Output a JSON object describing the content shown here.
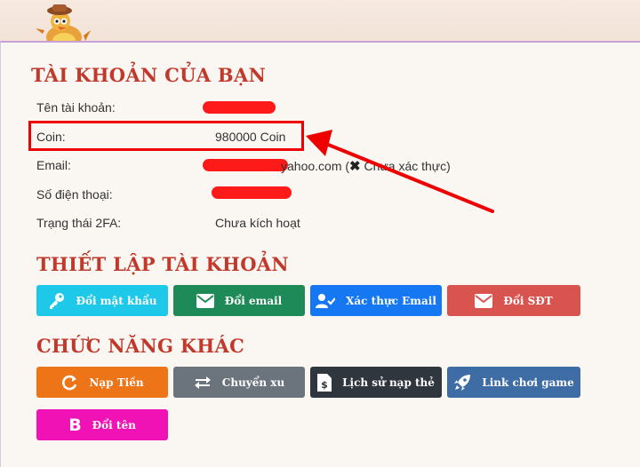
{
  "account": {
    "title": "TÀI KHOẢN CỦA BẠN",
    "username_label": "Tên tài khoản:",
    "coin_label": "Coin:",
    "coin_value": "980000 Coin",
    "email_label": "Email:",
    "email_visible_suffix": "yahoo.com (",
    "email_status": "Chưa xác thực)",
    "phone_label": "Số điện thoại:",
    "twofa_label": "Trạng thái 2FA:",
    "twofa_value": "Chưa kích hoạt"
  },
  "settings": {
    "title": "THIẾT LẬP TÀI KHOẢN",
    "buttons": [
      {
        "label": "Đổi mật khẩu",
        "icon": "key-icon",
        "color": "#1ec8e8"
      },
      {
        "label": "Đổi email",
        "icon": "envelope-icon",
        "color": "#1e8a57"
      },
      {
        "label": "Xác thực Email",
        "icon": "user-check-icon",
        "color": "#1677f2"
      },
      {
        "label": "Đổi SĐT",
        "icon": "envelope-icon",
        "color": "#d9534f"
      }
    ]
  },
  "other": {
    "title": "CHỨC NĂNG KHÁC",
    "buttons": [
      {
        "label": "Nạp Tiền",
        "icon": "refresh-icon",
        "color": "#ee7418"
      },
      {
        "label": "Chuyển xu",
        "icon": "exchange-icon",
        "color": "#6b747c"
      },
      {
        "label": "Lịch sử nạp thẻ",
        "icon": "receipt-icon",
        "color": "#2f363d"
      },
      {
        "label": "Link chơi game",
        "icon": "rocket-icon",
        "color": "#3e6da5"
      },
      {
        "label": "Đổi tên",
        "icon": "bold-b-icon",
        "color": "#f012b4"
      }
    ]
  },
  "colors": {
    "heading": "#c0392b",
    "annotation": "#ee0000"
  }
}
